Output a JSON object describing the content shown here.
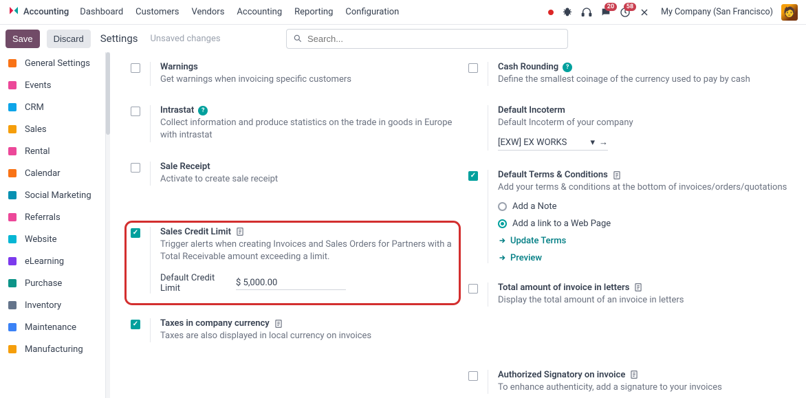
{
  "navbar": {
    "brand": "Accounting",
    "menu": [
      "Dashboard",
      "Customers",
      "Vendors",
      "Accounting",
      "Reporting",
      "Configuration"
    ],
    "badges": {
      "messages": "20",
      "activities": "58"
    },
    "company": "My Company (San Francisco)"
  },
  "actions": {
    "save": "Save",
    "discard": "Discard",
    "title": "Settings",
    "unsaved": "Unsaved changes",
    "search_placeholder": "Search..."
  },
  "sidebar": {
    "items": [
      {
        "label": "General Settings",
        "icon_color": "#f97316"
      },
      {
        "label": "Events",
        "icon_color": "#ec4899"
      },
      {
        "label": "CRM",
        "icon_color": "#0ea5e9"
      },
      {
        "label": "Sales",
        "icon_color": "#f59e0b"
      },
      {
        "label": "Rental",
        "icon_color": "#ec4899"
      },
      {
        "label": "Calendar",
        "icon_color": "#f97316"
      },
      {
        "label": "Social Marketing",
        "icon_color": "#0891b2"
      },
      {
        "label": "Referrals",
        "icon_color": "#ec4899"
      },
      {
        "label": "Website",
        "icon_color": "#06b6d4"
      },
      {
        "label": "eLearning",
        "icon_color": "#7c3aed"
      },
      {
        "label": "Purchase",
        "icon_color": "#0d9488"
      },
      {
        "label": "Inventory",
        "icon_color": "#64748b"
      },
      {
        "label": "Maintenance",
        "icon_color": "#3b82f6"
      },
      {
        "label": "Manufacturing",
        "icon_color": "#f59e0b"
      }
    ]
  },
  "left_col": {
    "warnings": {
      "title": "Warnings",
      "desc": "Get warnings when invoicing specific customers"
    },
    "intrastat": {
      "title": "Intrastat",
      "desc": "Collect information and produce statistics on the trade in goods in Europe with intrastat"
    },
    "sale_receipt": {
      "title": "Sale Receipt",
      "desc": "Activate to create sale receipt"
    },
    "scl": {
      "title": "Sales Credit Limit",
      "desc": "Trigger alerts when creating Invoices and Sales Orders for Partners with a Total Receivable amount exceeding a limit.",
      "field_label": "Default Credit Limit",
      "field_value": "$ 5,000.00"
    },
    "tcc": {
      "title": "Taxes in company currency",
      "desc": "Taxes are also displayed in local currency on invoices"
    }
  },
  "right_col": {
    "cash_rounding": {
      "title": "Cash Rounding",
      "desc": "Define the smallest coinage of the currency used to pay by cash"
    },
    "incoterm": {
      "title": "Default Incoterm",
      "desc": "Default Incoterm of your company",
      "value": "[EXW] EX WORKS"
    },
    "terms": {
      "title": "Default Terms & Conditions",
      "desc": "Add your terms & conditions at the bottom of invoices/orders/quotations",
      "opt_note": "Add a Note",
      "opt_link": "Add a link to a Web Page",
      "update": "Update Terms",
      "preview": "Preview"
    },
    "total_letters": {
      "title": "Total amount of invoice in letters",
      "desc": "Display the total amount of an invoice in letters"
    },
    "auth_sig": {
      "title": "Authorized Signatory on invoice",
      "desc": "To enhance authenticity, add a signature to your invoices"
    }
  }
}
